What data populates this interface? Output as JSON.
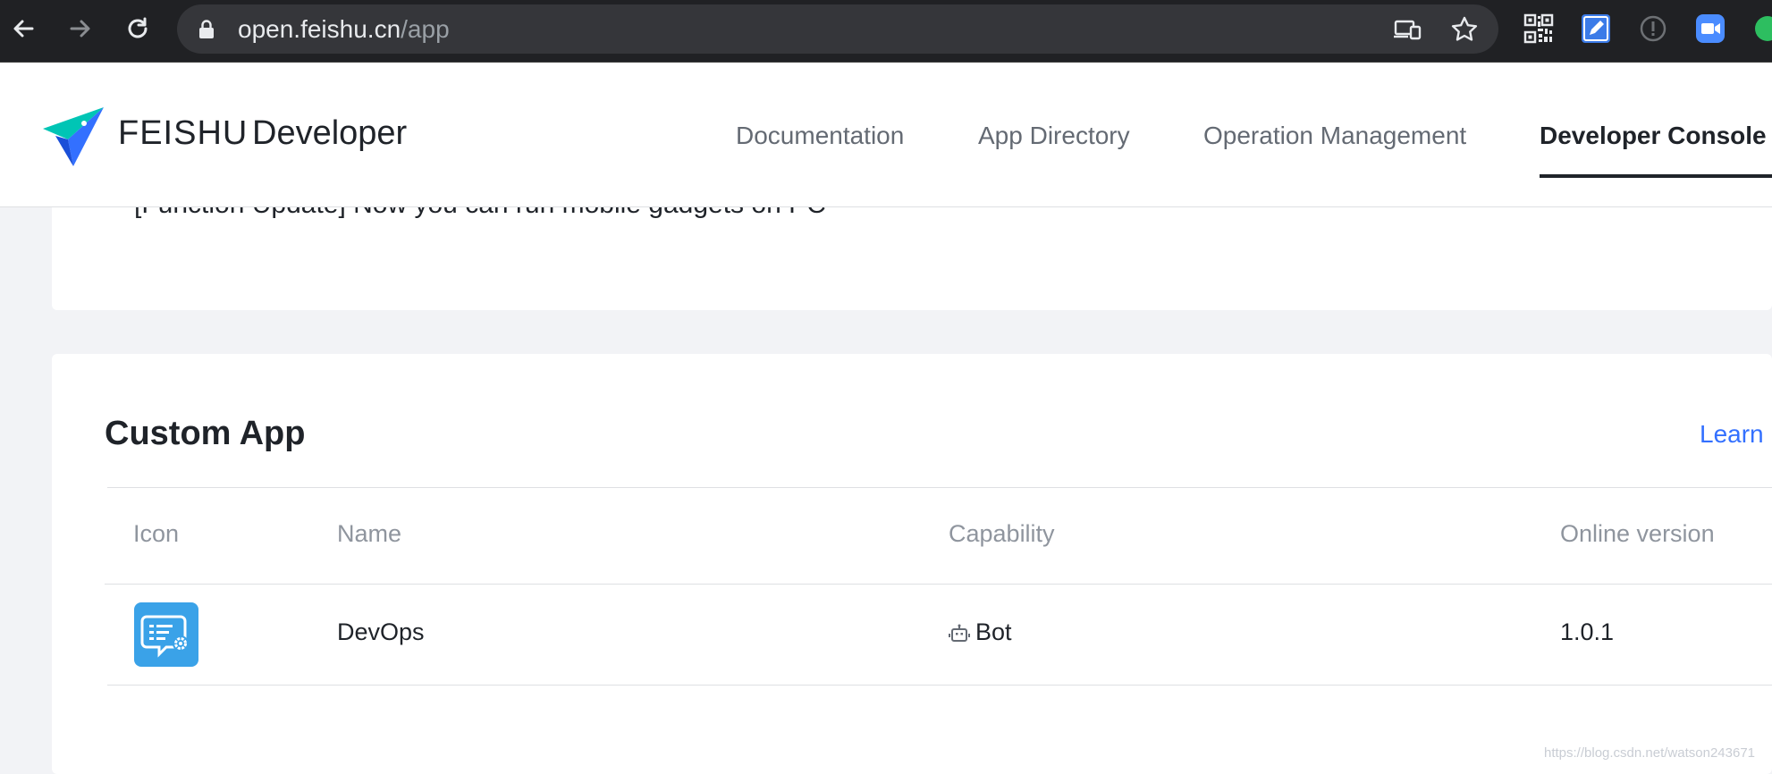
{
  "browser": {
    "url_host": "open.feishu.cn",
    "url_path": "/app",
    "icons": {
      "back": "arrow-left-icon",
      "forward": "arrow-right-icon",
      "reload": "reload-icon",
      "lock": "lock-icon",
      "cast": "devices-icon",
      "bookmark": "star-icon",
      "ext1": "qr-code-icon",
      "ext2": "edit-pen-icon",
      "ext3": "info-circle-icon",
      "ext4": "zoom-video-icon",
      "ext5": "evernote-icon"
    }
  },
  "header": {
    "brand": "FEISHU",
    "brand_sub": "Developer",
    "nav": [
      {
        "label": "Documentation"
      },
      {
        "label": "App Directory"
      },
      {
        "label": "Operation Management"
      },
      {
        "label": "Developer Console",
        "active": true
      }
    ]
  },
  "notice": {
    "text": "[Function Update] Now you can run mobile gadgets on PC"
  },
  "custom_app": {
    "title": "Custom App",
    "learn_label": "Learn",
    "columns": [
      "Icon",
      "Name",
      "Capability",
      "Online version"
    ],
    "rows": [
      {
        "icon": "devops-app-icon",
        "name": "DevOps",
        "capability": "Bot",
        "capability_icon": "robot-icon",
        "version": "1.0.1"
      }
    ]
  },
  "watermark": "https://blog.csdn.net/watson243671",
  "colors": {
    "accent": "#3370ff",
    "app_icon_bg": "#3aa2e8",
    "chrome_bg": "#202124",
    "page_bg": "#f2f3f6"
  }
}
